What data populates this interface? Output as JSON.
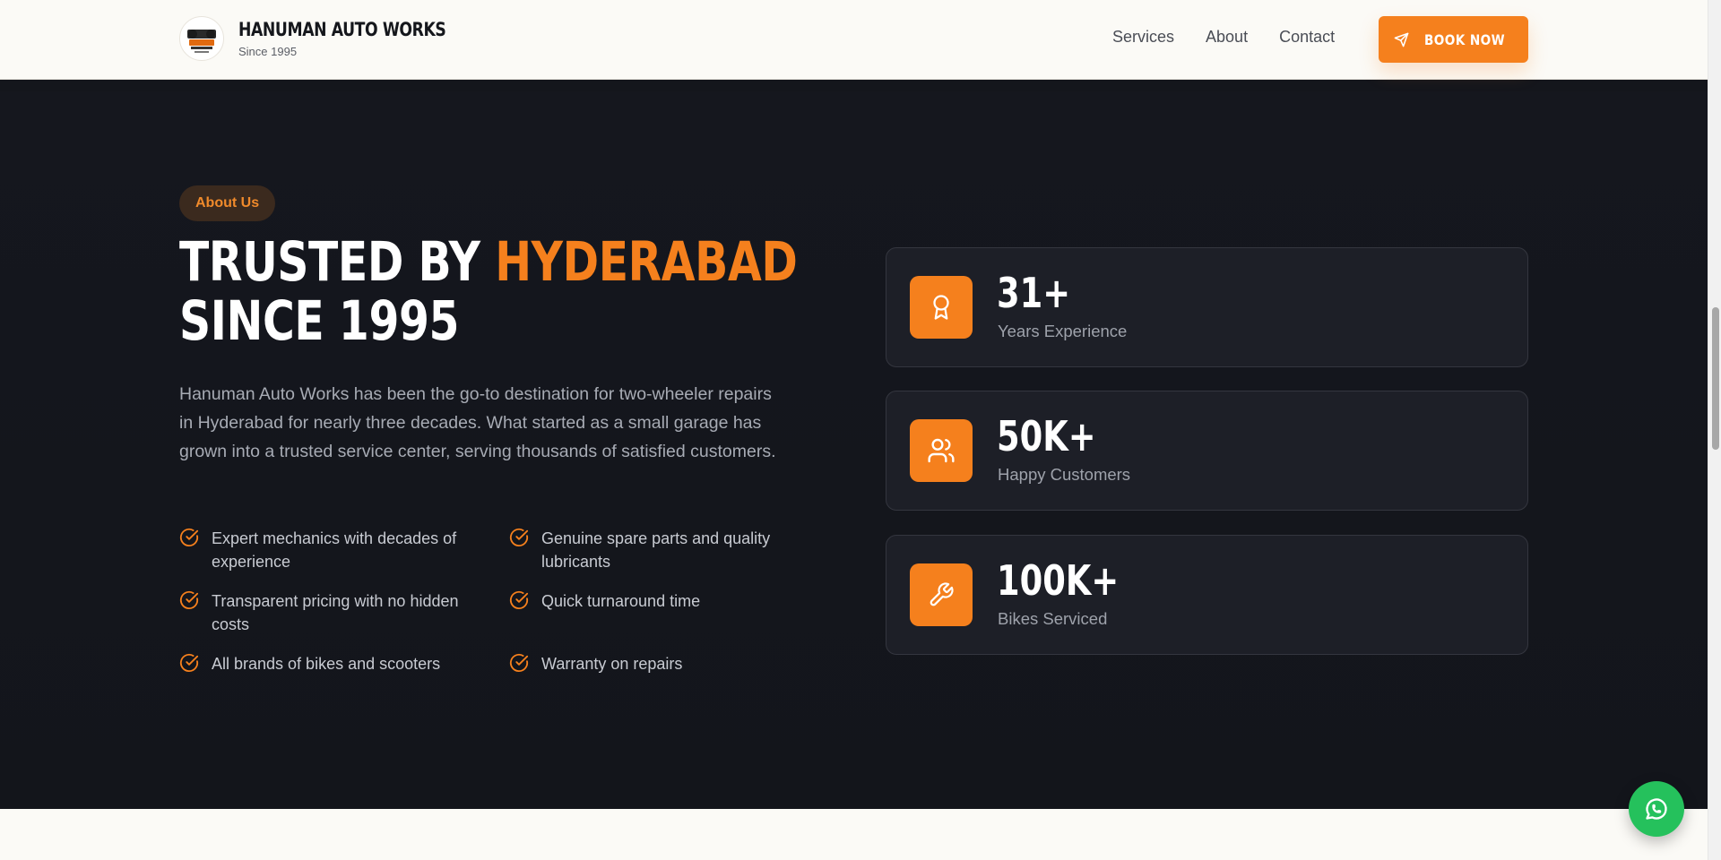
{
  "header": {
    "brand_name": "HANUMAN AUTO WORKS",
    "brand_sub": "Since 1995",
    "nav": [
      "Services",
      "About",
      "Contact"
    ],
    "cta_label": "BOOK NOW",
    "logo_icon": "hanuman-logo",
    "cta_icon": "send-icon"
  },
  "about": {
    "pill": "About Us",
    "headline_part1": "TRUSTED BY ",
    "headline_accent": "HYDERABAD",
    "headline_part2": "SINCE 1995",
    "description": "Hanuman Auto Works has been the go-to destination for two-wheeler repairs in Hyderabad for nearly three decades. What started as a small garage has grown into a trusted service center, serving thousands of satisfied customers.",
    "features": [
      "Expert mechanics with decades of experience",
      "Genuine spare parts and quality lubricants",
      "Transparent pricing with no hidden costs",
      "Quick turnaround time",
      "All brands of bikes and scooters",
      "Warranty on repairs"
    ],
    "stats": [
      {
        "value": "31+",
        "label": "Years Experience",
        "icon": "award-icon"
      },
      {
        "value": "50K+",
        "label": "Happy Customers",
        "icon": "users-icon"
      },
      {
        "value": "100K+",
        "label": "Bikes Serviced",
        "icon": "wrench-icon"
      }
    ]
  },
  "colors": {
    "accent": "#f5801d",
    "dark_bg": "#14161c",
    "light_bg": "#fbfaf6",
    "whatsapp": "#25c15c"
  },
  "floating": {
    "whatsapp_icon": "whatsapp-icon"
  }
}
